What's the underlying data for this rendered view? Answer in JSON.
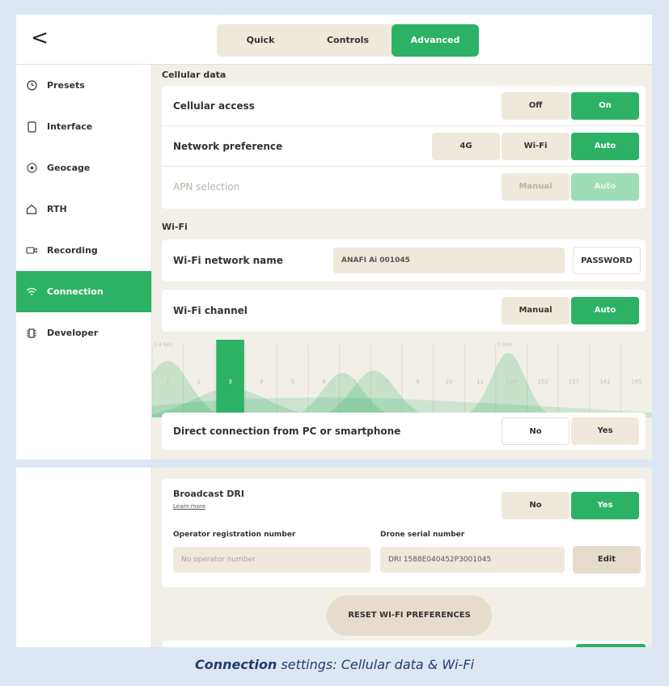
{
  "topbar": {
    "back_glyph": "<",
    "tabs": [
      "Quick",
      "Controls",
      "Advanced"
    ],
    "active_tab": 2
  },
  "sidebar": {
    "items": [
      {
        "label": "Presets",
        "icon": "clock-icon"
      },
      {
        "label": "Interface",
        "icon": "phone-icon"
      },
      {
        "label": "Geocage",
        "icon": "target-icon"
      },
      {
        "label": "RTH",
        "icon": "home-icon"
      },
      {
        "label": "Recording",
        "icon": "camera-icon"
      },
      {
        "label": "Connection",
        "icon": "wifi-icon"
      },
      {
        "label": "Developer",
        "icon": "chip-icon"
      }
    ],
    "active": 5
  },
  "cellular": {
    "title": "Cellular data",
    "access_label": "Cellular access",
    "access_off": "Off",
    "access_on": "On",
    "network_label": "Network preference",
    "net_4g": "4G",
    "net_wifi": "Wi-Fi",
    "net_auto": "Auto",
    "apn_label": "APN selection",
    "apn_manual": "Manual",
    "apn_auto": "Auto"
  },
  "wifi": {
    "title": "Wi-Fi",
    "name_label": "Wi-Fi network name",
    "name_value": "ANAFI Ai 001045",
    "password_button": "PASSWORD",
    "channel_label": "Wi-Fi channel",
    "channel_manual": "Manual",
    "channel_auto": "Auto",
    "band_24": "2.4 GHz",
    "band_5": "5 GHz",
    "channels": [
      "1",
      "2",
      "3",
      "4",
      "5",
      "6",
      "7",
      "8",
      "9",
      "10",
      "11",
      "149",
      "153",
      "157",
      "161",
      "165"
    ],
    "selected_channel": "3",
    "direct_label": "Direct connection from PC or smartphone",
    "direct_no": "No",
    "direct_yes": "Yes"
  },
  "dri": {
    "broadcast_label": "Broadcast DRI",
    "learn_more": "Learn more",
    "no": "No",
    "yes": "Yes",
    "operator_label": "Operator registration number",
    "operator_placeholder": "No operator number",
    "serial_label": "Drone serial number",
    "serial_value": "DRI 1588E040452P3001045",
    "edit_button": "Edit",
    "reset_button": "RESET WI-FI PREFERENCES"
  },
  "caption": {
    "bold": "Connection",
    "rest": " settings: Cellular data & Wi-Fi"
  },
  "colors": {
    "accent": "#2db265",
    "background": "#dde6f3",
    "panel": "#f2efe8",
    "caption": "#1f3e70"
  }
}
